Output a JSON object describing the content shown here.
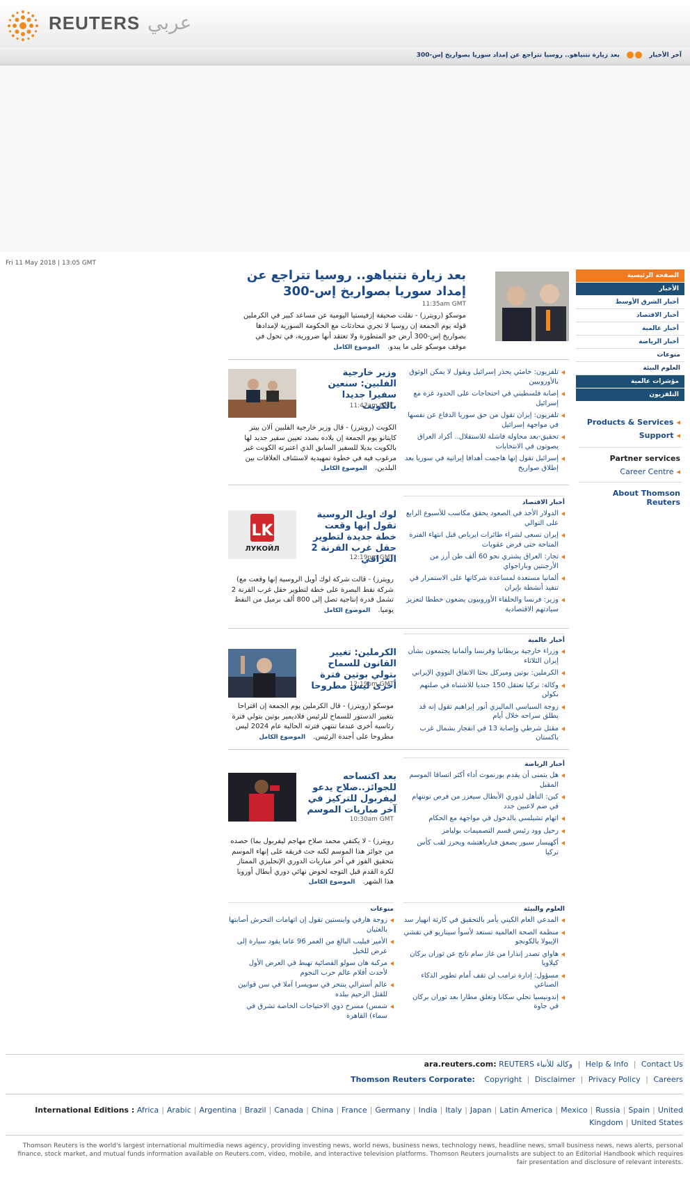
{
  "brand": {
    "name": "REUTERS",
    "arabic": "عربي"
  },
  "ticker": {
    "headline": "بعد زيارة نتنياهو.. روسيا تتراجع عن إمداد سوريا بصواريخ إس-300",
    "latest_label": "آخر الأخبار"
  },
  "dateline": "Fri 11 May 2018 | 13:05 GMT",
  "nav": {
    "home": "الصفحة الرئيسية",
    "news": "الأخبار",
    "news_items": [
      "أخبار الشرق الأوسط",
      "أخبار الاقتصاد",
      "أخبار عالمية",
      "أخبار الرياضة"
    ],
    "misc": "منوعات",
    "environment": "العلوم البيئة",
    "indices": "مؤشرات عالمية",
    "tv": "التلفزيون"
  },
  "services": {
    "products": "Products & Services",
    "support": "Support",
    "partner": "Partner services",
    "career": "Career Centre",
    "about": "About Thomson Reuters"
  },
  "top_story": {
    "title": "بعد زيارة نتنياهو.. روسيا تتراجع عن إمداد سوريا بصواريخ إس-300",
    "time": "11:35am GMT",
    "body": "موسكو (رويترز) - نقلت صحيفة إزفيستيا اليومية عن مساعد كبير في الكرملين قوله يوم الجمعة إن روسيا لا تجري محادثات مع الحكومة السورية لإمدادها بصواريخ إس-300 أرض جو المتطورة ولا تعتقد أنها ضرورية، في تحول في موقف موسكو على ما يبدو.",
    "more": "الموضوع الكامل"
  },
  "stories": [
    {
      "title": "وزير خارجية الفلبين: سنعين سفيرا جديدا بالكويت",
      "time": "11:47am GMT",
      "body": "الكويت (رويترز) - قال وزير خارجية الفلبين آلان بيتر كايتانو يوم الجمعة إن بلاده بصدد تعيين سفير جديد لها بالكويت بديلا للسفير السابق الذي اعتبرته الكويت غير مرغوب فيه في خطوة تمهيدية لاستئناف العلاقات بين البلدين.",
      "more": "الموضوع الكامل"
    },
    {
      "title": "لوك اويل الروسية تقول إنها وقعت خطة جديدة لتطوير حقل غرب القرنة 2 العراقي",
      "time": "12:19pm GMT",
      "body": "رويترز) - قالت شركة لوك أويل الروسية إنها وقعت مع) شركة نفط البصرة على خطة لتطوير حقل غرب القرنة 2 تشمل قدرة إنتاجية تصل إلى 800 ألف برميل من النفط يوميا.",
      "more": "الموضوع الكامل",
      "logo_text": "ЛУКОЙЛ"
    },
    {
      "title": "الكرملين: تغيير القانون للسماح بتولي بوتين فترة أخرى ليس مطروحا",
      "time": "12:19pm GMT",
      "body": "موسكو (رويترز) - قال الكرملين يوم الجمعة إن اقتراحا بتغيير الدستور للسماح للرئيس فلاديمير بوتين بتولي فترة رئاسية أخرى عندما تنتهي فترته الحالية عام 2024 ليس مطروحا على أجندة الرئيس.",
      "more": "الموضوع الكامل"
    },
    {
      "title": "بعد اكتساحه للجوائز..صلاح يدعو ليفربول للتركيز في آخر مباريات الموسم",
      "time": "10:30am GMT",
      "body": "رويترز) - لا يكتفي محمد صلاح مهاجم ليفربول بما) حصده من جوائز هذا الموسم لكنه حث فريقه على إنهاء الموسم بتحقيق الفوز في آخر مباريات الدوري الإنجليزي الممتاز لكرة القدم قبل التوجه لخوض نهائي دوري أبطال أوروبا هذا الشهر.",
      "more": "الموضوع الكامل"
    }
  ],
  "lists": {
    "middle_east": [
      "تلفزيون: خامئي يحذر إسرائيل ويقول لا يمكن الوثوق بالأوروبيين",
      "إصابة فلسطيني في احتجاجات على الحدود غزة مع إسرائيل",
      "تلفزيون: إيران تقول من حق سوريا الدفاع عن نفسها في مواجهة إسرائيل",
      "تحقيق-بعد محاولة فاشلة للاستقلال.. أكراد العراق يصوتون في الانتخابات",
      "إسرائيل تقول إنها هاجمت أهدافا إيرانية في سوريا بعد إطلاق صواريخ"
    ],
    "economy_head": "أخبار الاقتصاد",
    "economy": [
      "الدولار الأخذ في الصعود يحقق مكاسب للأسبوع الرابع على التوالي",
      "إيران تسعى لشراء طائرات ايرباص قبل انتهاء الفترة المتاحة حتى فرض عقوبات",
      "تجار: العراق يشتري نحو 60 ألف طن أرز من الأرجنتين وباراجواي",
      "ألمانيا مستعدة لمساعدة شركاتها على الاستمرار في تنفيذ أنشطة بإيران",
      "وزير: فرنسا والحلفاء الأوروبيون يضعون خططا لتعزيز سيادتهم الاقتصادية"
    ],
    "world_head": "أخبار عالمية",
    "world": [
      "وزراء خارجية بريطانيا وفرنسا وألمانيا يجتمعون بشأن إيران الثلاثاء",
      "الكرملين: بوتين وميركل بحثا الاتفاق النووي الإيراني",
      "وكالة: تركيا تعتقل 150 جنديا للاشتباه في صلتهم بكولن",
      "زوجة السياسي الماليزي أنور إبراهيم تقول إنه قد يطلق سراحه خلال أيام",
      "مقتل شرطي وإصابة 13 في انفجار بشمال غرب باكستان"
    ],
    "sports_head": "أخبار الرياضة",
    "sports": [
      "هل يتمنى أن يقدم بورنموث أداء أكثر اتساقا الموسم المقبل",
      "كين: التأهل لدوري الأبطال سيعزز من فرص توتنهام في ضم لاعبين جدد",
      "اتهام تشيلسي بالدخول في مواجهة مع الحكام",
      "رحيل وود رئيس قسم التصميمات بوليامز",
      "أكهيسار سبور يصعق فنارباهتشه ويحرز لقب كأس تركيا"
    ],
    "science_head": "العلوم والبيئة",
    "science": [
      "المدعي العام الكيني يأمر بالتحقيق في كارثة انهيار سد",
      "منظمة الصحة العالمية تستعد لأسوأ سيناريو في تفشي الإيبولا بالكونجو",
      "هاواي تصدر إنذارا من غاز سام ناتج عن ثوران بركان كيلاويا",
      "مسؤول: إدارة ترامب لن تقف أمام تطوير الذكاء الصناعي",
      "إندونيسيا تجلي سكانا وتغلق مطارا بعد ثوران بركان في جاوة"
    ],
    "misc_head": "منوعات",
    "misc": [
      "زوجة هارفي واينستين تقول إن اتهامات التحرش أصابتها بالغثيان",
      "الأمير فيليب البالغ من العمر 96 عاما يقود سيارة إلى عرض للخيل",
      "مركبة هان سولو الفضائية تهبط في العرض الأول لأحدث أفلام عالم حرب النجوم",
      "عالم أسترالي ينتحر في سويسرا آملا في سن قوانين للقتل الرحيم ببلده",
      "شمس) مسرح ذوي الاحتياجات الخاصة تشرق في سماء) القاهرة"
    ]
  },
  "footer": {
    "site": "ara.reuters.com:",
    "agency": "REUTERS وكالة للأنباء",
    "help": "Help & Info",
    "contact": "Contact Us",
    "corporate": "Thomson Reuters Corporate:",
    "copyright": "Copyright",
    "disclaimer": "Disclaimer",
    "privacy": "Privacy Policy",
    "careers": "Careers",
    "editions_label": "International Editions :",
    "editions": [
      "Africa",
      "Arabic",
      "Argentina",
      "Brazil",
      "Canada",
      "China",
      "France",
      "Germany",
      "India",
      "Italy",
      "Japan",
      "Latin America",
      "Mexico",
      "Russia",
      "Spain",
      "United Kingdom",
      "United States"
    ],
    "legal": "Thomson Reuters is the world's largest international multimedia news agency, providing investing news, world news, business news, technology news, headline news, small business news, news alerts, personal finance, stock market, and mutual funds information available on Reuters.com, video, mobile, and interactive television platforms. Thomson Reuters journalists are subject to an Editorial Handbook which requires fair presentation and disclosure of relevant interests."
  },
  "colors": {
    "accent": "#ef7a22",
    "nav_dark": "#1d4f75",
    "link": "#1a4a8a"
  }
}
